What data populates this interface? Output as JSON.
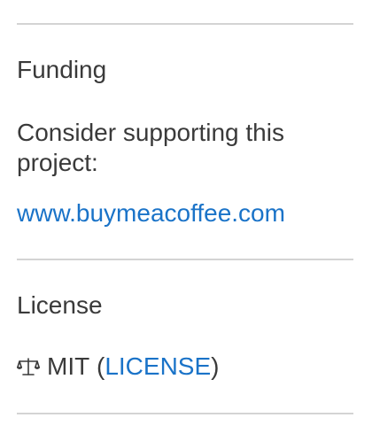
{
  "funding": {
    "heading": "Funding",
    "description": "Consider supporting this project:",
    "link_text": "www.buymeacoffee.com"
  },
  "license": {
    "heading": "License",
    "icon": "scale-balance-icon",
    "name": "MIT",
    "open_paren": " (",
    "link_text": "LICENSE",
    "close_paren": ")"
  },
  "colors": {
    "link": "#1a73c8",
    "text": "#3a3a3a",
    "divider": "#d4d4d4"
  }
}
